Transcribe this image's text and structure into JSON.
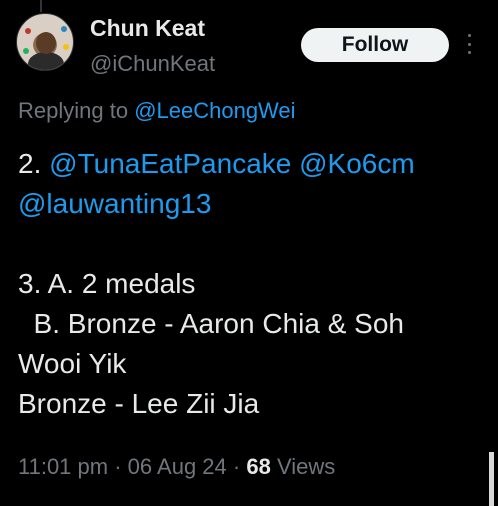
{
  "author": {
    "display_name": "Chun Keat",
    "handle": "@iChunKeat"
  },
  "follow_button": {
    "label": "Follow"
  },
  "more_menu": {
    "icon": "more-vertical-icon"
  },
  "reply_context": {
    "prefix": "Replying to ",
    "mention": "@LeeChongWei"
  },
  "tweet": {
    "line1_prefix": "2. ",
    "mention1": "@TunaEatPancake",
    "mention2": "@Ko6cm",
    "mention3": "@lauwanting13",
    "line3": "3. A. 2 medals",
    "line4": "  B. Bronze - Aaron Chia & Soh",
    "line5": "Wooi Yik",
    "line6": "Bronze - Lee Zii Jia"
  },
  "meta": {
    "time": "11:01 pm",
    "separator": " · ",
    "date": "06 Aug 24",
    "views_count": "68",
    "views_label": " Views"
  },
  "colors": {
    "background": "#000000",
    "text": "#e7e9ea",
    "muted": "#71767b",
    "link": "#1d9bf0"
  }
}
